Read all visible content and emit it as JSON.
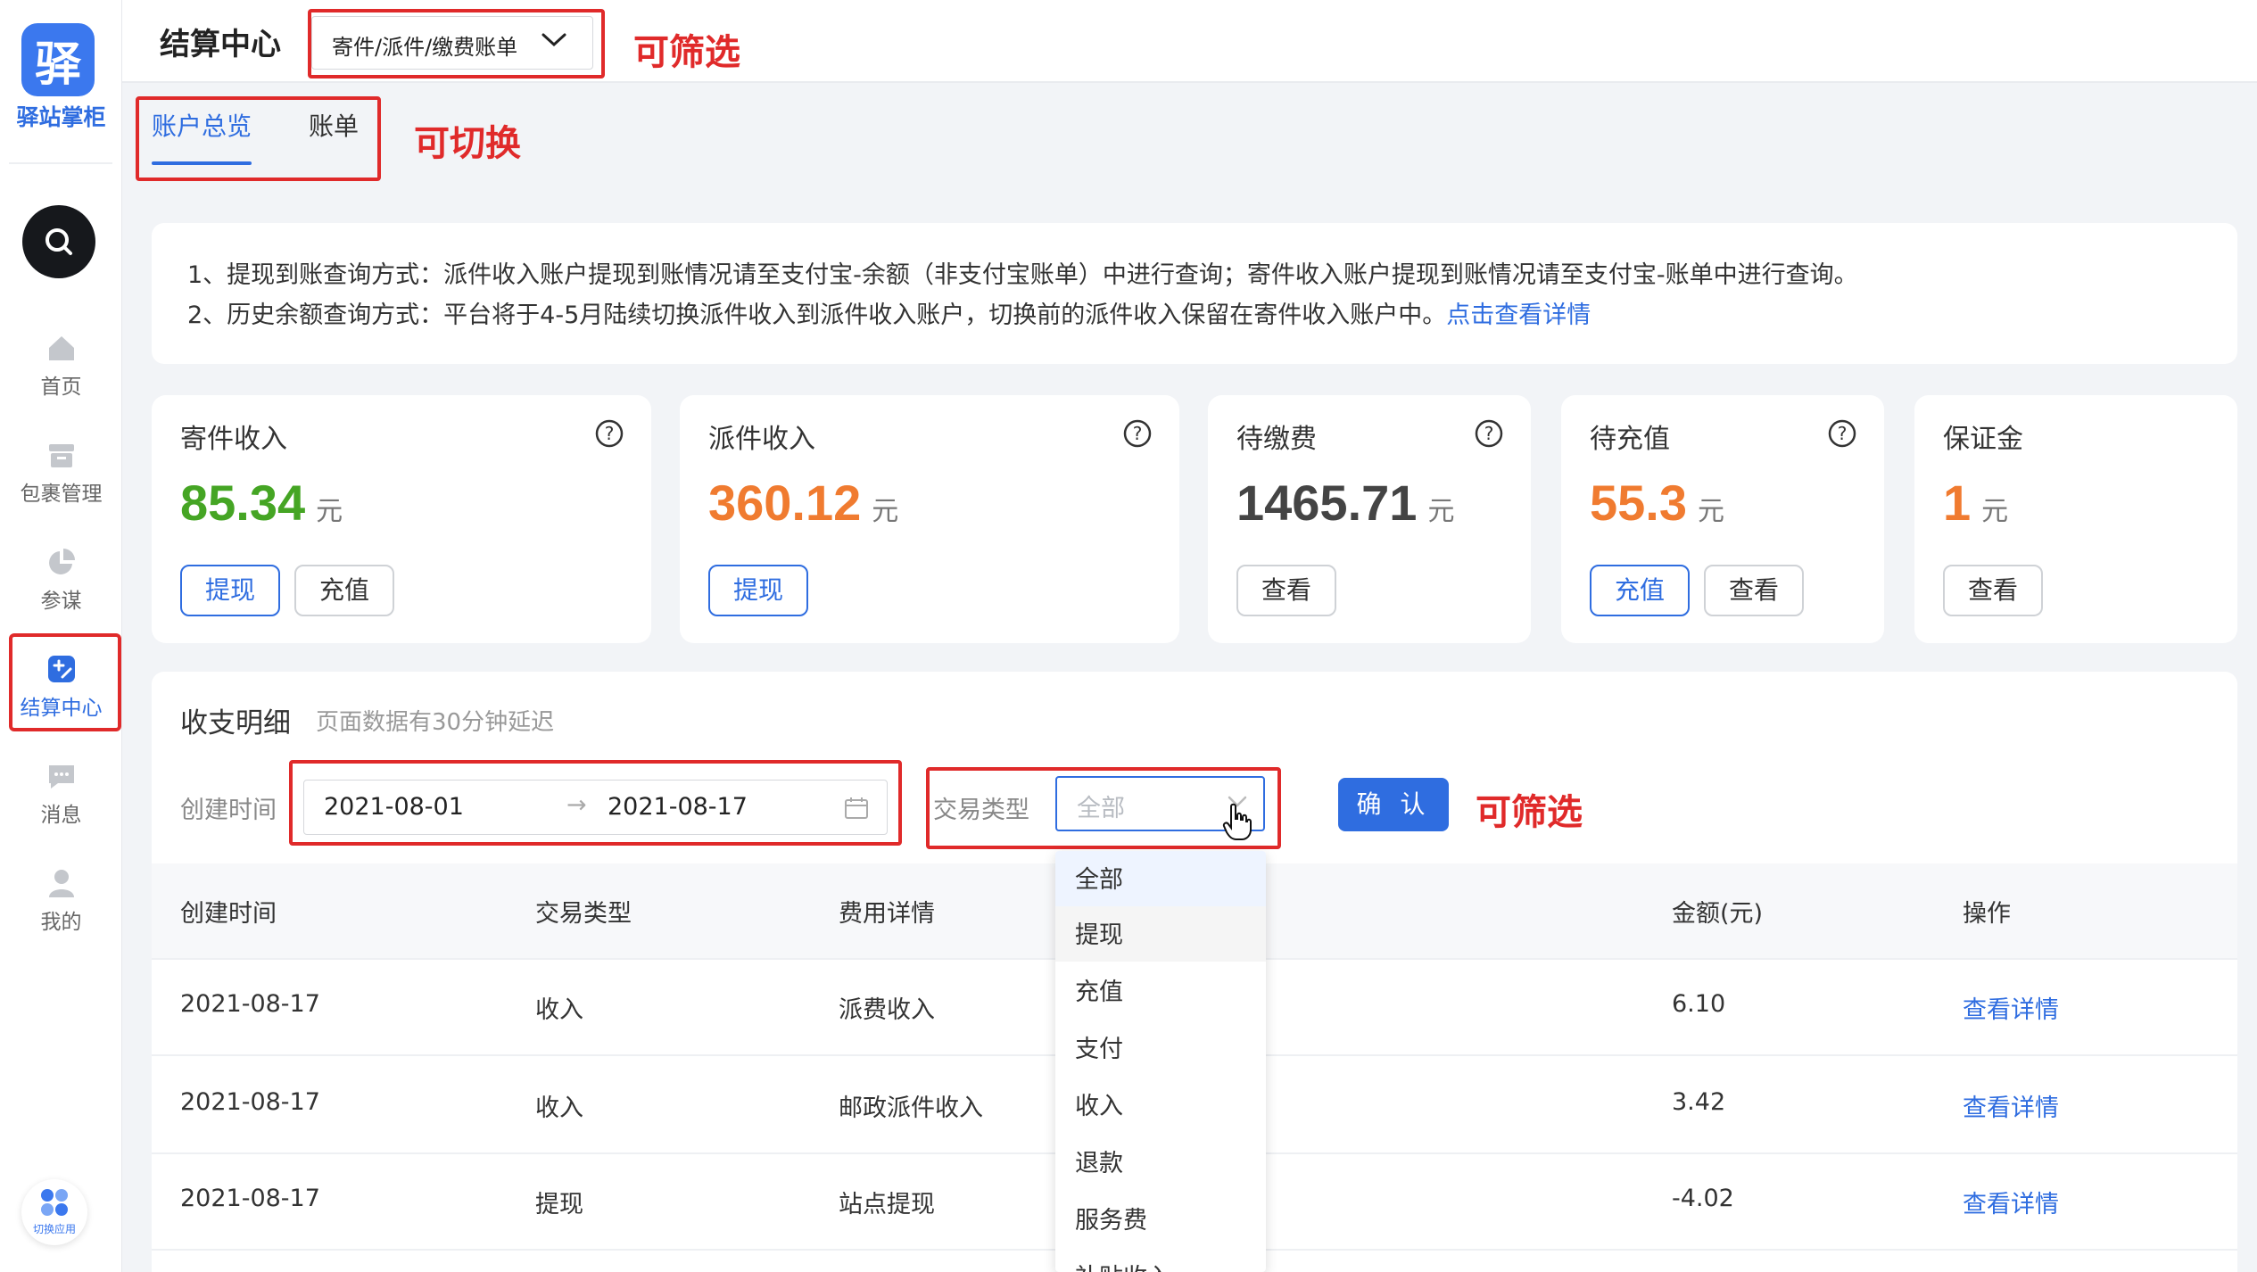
{
  "app": {
    "logo_char": "驿",
    "name": "驿站掌柜",
    "switch_app_label": "切换应用"
  },
  "sidebar": {
    "items": [
      {
        "label": "首页",
        "icon": "home-icon"
      },
      {
        "label": "包裹管理",
        "icon": "package-icon"
      },
      {
        "label": "参谋",
        "icon": "pie-chart-icon"
      },
      {
        "label": "结算中心",
        "icon": "settlement-icon",
        "active": true
      },
      {
        "label": "消息",
        "icon": "message-icon"
      },
      {
        "label": "我的",
        "icon": "user-icon"
      }
    ]
  },
  "header": {
    "title": "结算中心",
    "scope_select": "寄件/派件/缴费账单"
  },
  "annotations": {
    "filter_1": "可筛选",
    "switch": "可切换",
    "filter_2": "可筛选"
  },
  "tabs": [
    {
      "label": "账户总览",
      "active": true
    },
    {
      "label": "账单",
      "active": false
    }
  ],
  "notice": {
    "line1": "1、提现到账查询方式：派件收入账户提现到账情况请至支付宝-余额（非支付宝账单）中进行查询；寄件收入账户提现到账情况请至支付宝-账单中进行查询。",
    "line2": "2、历史余额查询方式：平台将于4-5月陆续切换派件收入到派件收入账户，切换前的派件收入保留在寄件收入账户中。",
    "link": "点击查看详情"
  },
  "cards": [
    {
      "title": "寄件收入",
      "value": "85.34",
      "unit": "元",
      "color": "#45a524",
      "buttons": [
        "提现",
        "充值"
      ]
    },
    {
      "title": "派件收入",
      "value": "360.12",
      "unit": "元",
      "color": "#f07b30",
      "buttons": [
        "提现"
      ]
    },
    {
      "title": "待缴费",
      "value": "1465.71",
      "unit": "元",
      "color": "#444444",
      "buttons": [
        "查看"
      ]
    },
    {
      "title": "待充值",
      "value": "55.3",
      "unit": "元",
      "color": "#f07b30",
      "buttons": [
        "充值",
        "查看"
      ]
    },
    {
      "title": "保证金",
      "value": "1",
      "unit": "元",
      "color": "#f07b30",
      "buttons": [
        "查看"
      ]
    }
  ],
  "details": {
    "title": "收支明细",
    "subtitle": "页面数据有30分钟延迟",
    "filters": {
      "created_label": "创建时间",
      "date_start": "2021-08-01",
      "date_arrow": "→",
      "date_end": "2021-08-17",
      "type_label": "交易类型",
      "type_placeholder": "全部",
      "confirm": "确 认"
    },
    "columns": [
      "创建时间",
      "交易类型",
      "费用详情",
      "金额(元)",
      "操作"
    ],
    "rows": [
      {
        "date": "2021-08-17",
        "type": "收入",
        "detail": "派费收入",
        "amount": "6.10",
        "action": "查看详情"
      },
      {
        "date": "2021-08-17",
        "type": "收入",
        "detail": "邮政派件收入",
        "amount": "3.42",
        "action": "查看详情"
      },
      {
        "date": "2021-08-17",
        "type": "提现",
        "detail": "站点提现",
        "amount": "-4.02",
        "action": "查看详情"
      }
    ],
    "dropdown_options": [
      "全部",
      "提现",
      "充值",
      "支付",
      "收入",
      "退款",
      "服务费",
      "补贴收入"
    ]
  },
  "colors": {
    "accent": "#2f6de0",
    "highlight": "#e02a2a",
    "green": "#45a524",
    "orange": "#f07b30"
  }
}
